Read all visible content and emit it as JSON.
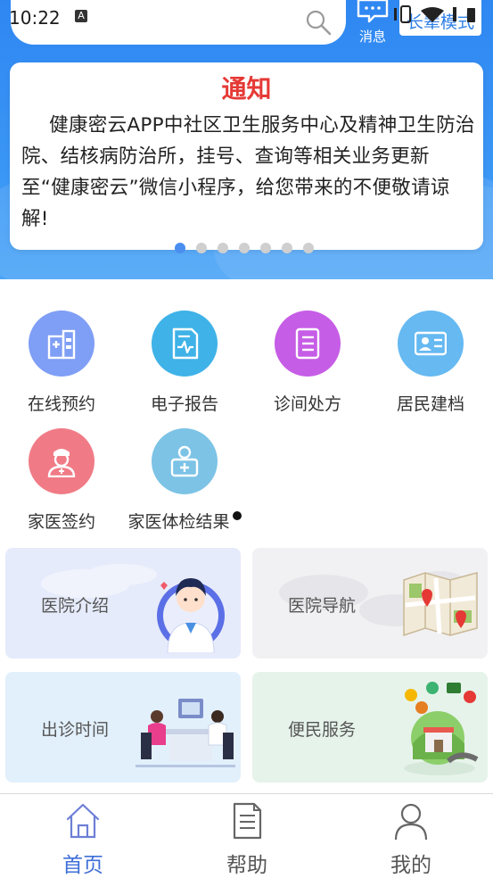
{
  "status_bar": {
    "time": "10:22",
    "notification_glyph": "A"
  },
  "header": {
    "messages_label": "消息",
    "care_mode_label": "长辈模式"
  },
  "notice": {
    "title": "通知",
    "body": "健康密云APP中社区卫生服务中心及精神卫生防治院、结核病防治所，挂号、查询等相关业务更新至“健康密云”微信小程序，给您带来的不便敬请谅解!",
    "carousel_count": 7,
    "carousel_active_index": 0
  },
  "functions": [
    {
      "label": "在线预约",
      "icon": "hospital-building-icon",
      "color": "#7f9ef5"
    },
    {
      "label": "电子报告",
      "icon": "report-document-icon",
      "color": "#3fb2e8"
    },
    {
      "label": "诊间处方",
      "icon": "prescription-list-icon",
      "color": "#c65de6"
    },
    {
      "label": "居民建档",
      "icon": "id-card-icon",
      "color": "#66b9f1"
    },
    {
      "label": "家医签约",
      "icon": "doctor-icon",
      "color": "#f07b86"
    },
    {
      "label": "家医体检结果",
      "icon": "medical-kit-icon",
      "color": "#7cc3e6",
      "badge": true
    }
  ],
  "cards": [
    {
      "label": "医院介绍",
      "bg": "#e6ebfb"
    },
    {
      "label": "医院导航",
      "bg": "#f1f1f3"
    },
    {
      "label": "出诊时间",
      "bg": "#e2f0fc"
    },
    {
      "label": "便民服务",
      "bg": "#e6f3ea"
    }
  ],
  "bottom_nav": [
    {
      "label": "首页",
      "icon": "home-icon",
      "active": true
    },
    {
      "label": "帮助",
      "icon": "help-document-icon",
      "active": false
    },
    {
      "label": "我的",
      "icon": "user-icon",
      "active": false
    }
  ],
  "colors": {
    "header_blue": "#2f87f2",
    "notice_red": "#e53935",
    "nav_active": "#3f6fd8"
  }
}
